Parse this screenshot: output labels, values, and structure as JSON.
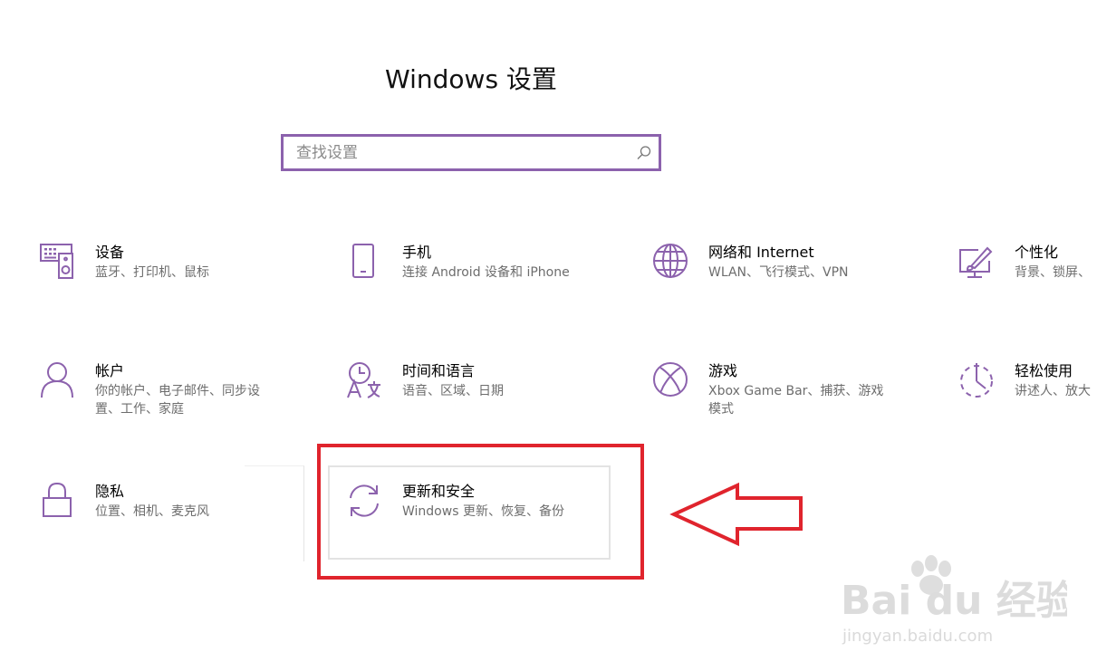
{
  "window": {
    "title": "Windows 设置"
  },
  "search": {
    "placeholder": "查找设置"
  },
  "accent_color": "#8c62ad",
  "highlight_color": "#e0242d",
  "tiles": [
    {
      "icon": "devices-icon",
      "title": "设备",
      "subtitle": "蓝牙、打印机、鼠标"
    },
    {
      "icon": "phone-icon",
      "title": "手机",
      "subtitle": "连接 Android 设备和 iPhone"
    },
    {
      "icon": "globe-icon",
      "title": "网络和 Internet",
      "subtitle": "WLAN、飞行模式、VPN"
    },
    {
      "icon": "personalization-icon",
      "title": "个性化",
      "subtitle": "背景、锁屏、"
    },
    {
      "icon": "person-icon",
      "title": "帐户",
      "subtitle_line1": "你的帐户、电子邮件、同步设",
      "subtitle_line2": "置、工作、家庭"
    },
    {
      "icon": "time-language-icon",
      "title": "时间和语言",
      "subtitle": "语音、区域、日期"
    },
    {
      "icon": "xbox-icon",
      "title": "游戏",
      "subtitle_line1": "Xbox Game Bar、捕获、游戏",
      "subtitle_line2": "模式"
    },
    {
      "icon": "ease-of-access-icon",
      "title": "轻松使用",
      "subtitle": "讲述人、放大"
    },
    {
      "icon": "lock-icon",
      "title": "隐私",
      "subtitle": "位置、相机、麦克风"
    },
    {
      "icon": "sync-icon",
      "title": "更新和安全",
      "subtitle": "Windows 更新、恢复、备份"
    }
  ],
  "watermark": {
    "logo": "Bai du 经验",
    "url": "jingyan.baidu.com"
  }
}
